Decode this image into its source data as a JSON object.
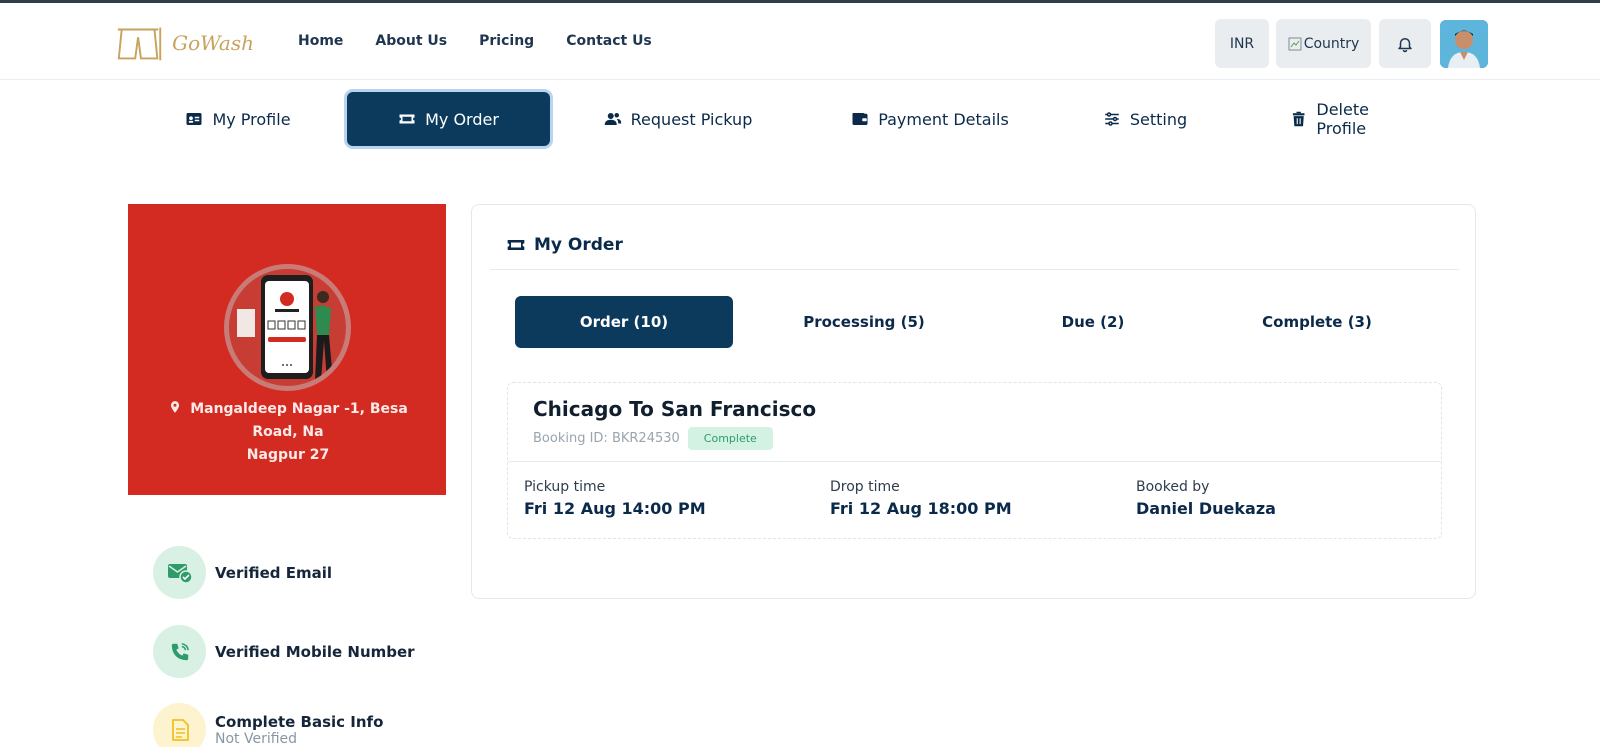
{
  "header": {
    "logo_text": "GoWash",
    "nav": [
      "Home",
      "About Us",
      "Pricing",
      "Contact Us"
    ],
    "currency": "INR",
    "country_alt": "Country"
  },
  "tabs": [
    {
      "label": "My Profile",
      "icon": "id-card-icon"
    },
    {
      "label": "My Order",
      "icon": "ticket-icon",
      "active": true
    },
    {
      "label": "Request Pickup",
      "icon": "users-icon"
    },
    {
      "label": "Payment Details",
      "icon": "wallet-icon"
    },
    {
      "label": "Setting",
      "icon": "sliders-icon"
    },
    {
      "label": "Delete Profile",
      "icon": "trash-icon"
    }
  ],
  "profile": {
    "address_line1": "Mangaldeep Nagar -1, Besa Road, Na",
    "address_line2": "Nagpur 27",
    "verifications": [
      {
        "label": "Verified Email",
        "icon": "envelope-check-icon"
      },
      {
        "label": "Verified Mobile Number",
        "icon": "phone-icon"
      },
      {
        "label": "Complete Basic Info",
        "sub": "Not Verified",
        "icon": "document-icon"
      }
    ]
  },
  "orders": {
    "heading": "My Order",
    "tabs": [
      "Order (10)",
      "Processing (5)",
      "Due (2)",
      "Complete (3)"
    ],
    "card": {
      "route": "Chicago To San Francisco",
      "booking_id": "Booking ID: BKR24530",
      "status": "Complete",
      "pickup_label": "Pickup time",
      "pickup_value": "Fri 12 Aug 14:00 PM",
      "drop_label": "Drop time",
      "drop_value": "Fri 12 Aug 18:00 PM",
      "booked_label": "Booked by",
      "booked_value": "Daniel Duekaza"
    }
  },
  "colors": {
    "primary": "#0b3a5c",
    "profile_bg": "#d32b22",
    "badge_bg": "#d4f2e4",
    "badge_text": "#2f9b6b"
  }
}
